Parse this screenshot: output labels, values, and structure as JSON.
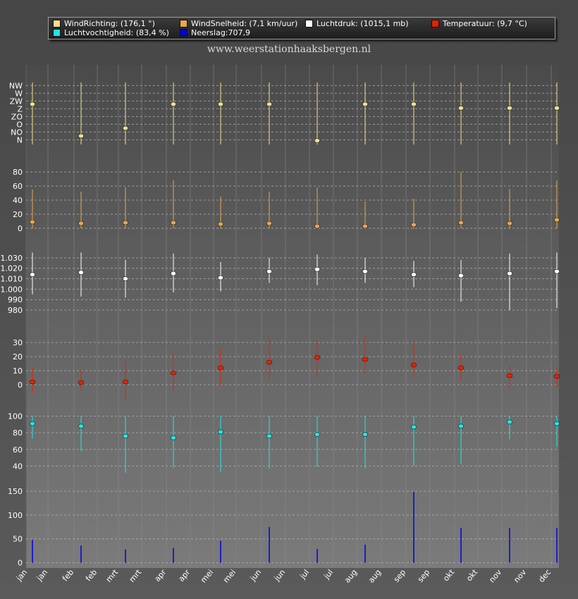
{
  "legend": [
    {
      "label": "WindRichting: (176,1 °)",
      "color": "#f5e08c"
    },
    {
      "label": "WindSnelheid: (7,1 km/uur)",
      "color": "#e8a84a"
    },
    {
      "label": "Luchtdruk: (1015,1 mb)",
      "color": "#ffffff"
    },
    {
      "label": "Temperatuur: (9,7 °C)",
      "color": "#e82000"
    },
    {
      "label": "Luchtvochtigheid: (83,4 %)",
      "color": "#1ee8e8"
    },
    {
      "label": "Neerslag:707,9",
      "color": "#0000e0"
    }
  ],
  "site_title": "www.weerstationhaaksbergen.nl",
  "x_tick_labels": [
    "jan",
    "jan",
    "feb",
    "feb",
    "mrt",
    "mrt",
    "apr",
    "apr",
    "mei",
    "mei",
    "jun",
    "jun",
    "jul",
    "jul",
    "aug",
    "aug",
    "sep",
    "sep",
    "okt",
    "okt",
    "nov",
    "nov",
    "dec"
  ],
  "chart_data": [
    {
      "type": "scatter",
      "name": "WindRichting",
      "color": "#f5e08c",
      "y_axis_ticks": [
        "NW",
        "W",
        "ZW",
        "Z",
        "ZO",
        "O",
        "NO",
        "N"
      ],
      "categories": [
        "jan",
        "feb",
        "mrt",
        "apr",
        "mei",
        "jun",
        "jul",
        "aug",
        "sep",
        "okt",
        "nov",
        "dec"
      ],
      "values": [
        5.2,
        1.1,
        2.1,
        5.2,
        5.2,
        5.2,
        0.5,
        5.2,
        5.2,
        4.7,
        4.7,
        4.7
      ],
      "ranges": [
        [
          0,
          8
        ],
        [
          0,
          8
        ],
        [
          0,
          8
        ],
        [
          0,
          8
        ],
        [
          0,
          8
        ],
        [
          0,
          8
        ],
        [
          0,
          8
        ],
        [
          0,
          8
        ],
        [
          0,
          8
        ],
        [
          0,
          8
        ],
        [
          0,
          8
        ],
        [
          0,
          8
        ]
      ],
      "ylim": [
        0,
        8
      ]
    },
    {
      "type": "scatter",
      "name": "WindSnelheid",
      "color": "#e8a84a",
      "y_ticks": [
        0,
        20,
        40,
        60,
        80
      ],
      "categories": [
        "jan",
        "feb",
        "mrt",
        "apr",
        "mei",
        "jun",
        "jul",
        "aug",
        "sep",
        "okt",
        "nov",
        "dec"
      ],
      "values": [
        9,
        7,
        8,
        8,
        6,
        7,
        3,
        3,
        5,
        8,
        7,
        12
      ],
      "ranges": [
        [
          0,
          55
        ],
        [
          0,
          52
        ],
        [
          0,
          58
        ],
        [
          0,
          68
        ],
        [
          0,
          45
        ],
        [
          0,
          52
        ],
        [
          0,
          58
        ],
        [
          0,
          38
        ],
        [
          0,
          42
        ],
        [
          0,
          80
        ],
        [
          0,
          56
        ],
        [
          0,
          68
        ]
      ],
      "ylim": [
        0,
        90
      ]
    },
    {
      "type": "scatter",
      "name": "Luchtdruk",
      "color": "#ffffff",
      "y_ticks": [
        "980",
        "990",
        "1.000",
        "1.010",
        "1.020",
        "1.030"
      ],
      "categories": [
        "jan",
        "feb",
        "mrt",
        "apr",
        "mei",
        "jun",
        "jul",
        "aug",
        "sep",
        "okt",
        "nov",
        "dec"
      ],
      "values": [
        1014,
        1016,
        1010,
        1015,
        1011,
        1017,
        1019,
        1017,
        1014,
        1013,
        1015,
        1017
      ],
      "ranges": [
        [
          995,
          1035
        ],
        [
          993,
          1035
        ],
        [
          992,
          1028
        ],
        [
          997,
          1034
        ],
        [
          998,
          1026
        ],
        [
          1006,
          1030
        ],
        [
          1004,
          1033
        ],
        [
          1006,
          1030
        ],
        [
          1002,
          1027
        ],
        [
          988,
          1028
        ],
        [
          980,
          1034
        ],
        [
          982,
          1035
        ]
      ],
      "ylim": [
        976,
        1040
      ]
    },
    {
      "type": "scatter",
      "name": "Temperatuur",
      "color": "#e82000",
      "y_ticks": [
        0,
        10,
        20,
        30
      ],
      "categories": [
        "jan",
        "feb",
        "mrt",
        "apr",
        "mei",
        "jun",
        "jul",
        "aug",
        "sep",
        "okt",
        "nov",
        "dec"
      ],
      "values": [
        2,
        1.5,
        2,
        8.5,
        12,
        16,
        19.5,
        18,
        14,
        12,
        6.5,
        6
      ],
      "ranges": [
        [
          -6,
          12
        ],
        [
          -4,
          11
        ],
        [
          -10,
          17
        ],
        [
          -5,
          22
        ],
        [
          0,
          26
        ],
        [
          4,
          33
        ],
        [
          6,
          32
        ],
        [
          8,
          35
        ],
        [
          5,
          31
        ],
        [
          3,
          22
        ],
        [
          -2,
          14
        ],
        [
          -2,
          12
        ]
      ],
      "ylim": [
        -10,
        36
      ]
    },
    {
      "type": "scatter",
      "name": "Luchtvochtigheid",
      "color": "#1ee8e8",
      "y_ticks": [
        40,
        60,
        80,
        100
      ],
      "categories": [
        "jan",
        "feb",
        "mrt",
        "apr",
        "mei",
        "jun",
        "jul",
        "aug",
        "sep",
        "okt",
        "nov",
        "dec"
      ],
      "values": [
        91,
        88,
        76,
        74,
        81,
        76,
        78,
        78,
        87,
        88,
        93,
        91
      ],
      "ranges": [
        [
          73,
          100
        ],
        [
          58,
          100
        ],
        [
          32,
          100
        ],
        [
          38,
          100
        ],
        [
          33,
          100
        ],
        [
          37,
          100
        ],
        [
          39,
          100
        ],
        [
          37,
          100
        ],
        [
          40,
          100
        ],
        [
          43,
          100
        ],
        [
          72,
          100
        ],
        [
          63,
          100
        ]
      ],
      "ylim": [
        20,
        103
      ]
    },
    {
      "type": "bar",
      "name": "Neerslag",
      "color": "#0000e0",
      "y_ticks": [
        0,
        50,
        100,
        150
      ],
      "categories": [
        "jan",
        "feb",
        "mrt",
        "apr",
        "mei",
        "jun",
        "jul",
        "aug",
        "sep",
        "okt",
        "nov",
        "dec"
      ],
      "values": [
        48,
        36,
        28,
        31,
        46,
        75,
        29,
        38,
        148,
        73,
        73,
        73
      ],
      "ylim": [
        -2,
        175
      ]
    }
  ]
}
